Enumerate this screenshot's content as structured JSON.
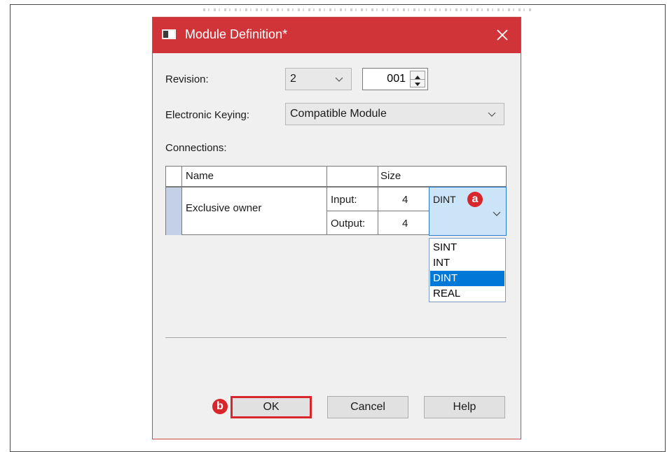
{
  "dialog": {
    "title": "Module Definition*",
    "close_symbol": "✕"
  },
  "revision": {
    "label": "Revision:",
    "major": "2",
    "minor": "001"
  },
  "keying": {
    "label": "Electronic Keying:",
    "value": "Compatible Module"
  },
  "connections": {
    "label": "Connections:",
    "headers": {
      "name": "Name",
      "blank": "",
      "size": "Size"
    },
    "row": {
      "name": "Exclusive owner",
      "input_label": "Input:",
      "input_size": "4",
      "output_label": "Output:",
      "output_size": "4",
      "type_value": "DINT"
    }
  },
  "dropdown": {
    "options": [
      "SINT",
      "INT",
      "DINT",
      "REAL"
    ],
    "selected": "DINT"
  },
  "callouts": {
    "a": "a",
    "b": "b"
  },
  "buttons": {
    "ok": "OK",
    "cancel": "Cancel",
    "help": "Help"
  },
  "colors": {
    "titlebar": "#d13438",
    "selection": "#0078d7",
    "callout": "#d7262c",
    "active_cell": "#cce4f7"
  },
  "icons": [
    "module-icon",
    "close-icon",
    "chevron-down-icon",
    "spin-up-icon",
    "spin-down-icon"
  ]
}
